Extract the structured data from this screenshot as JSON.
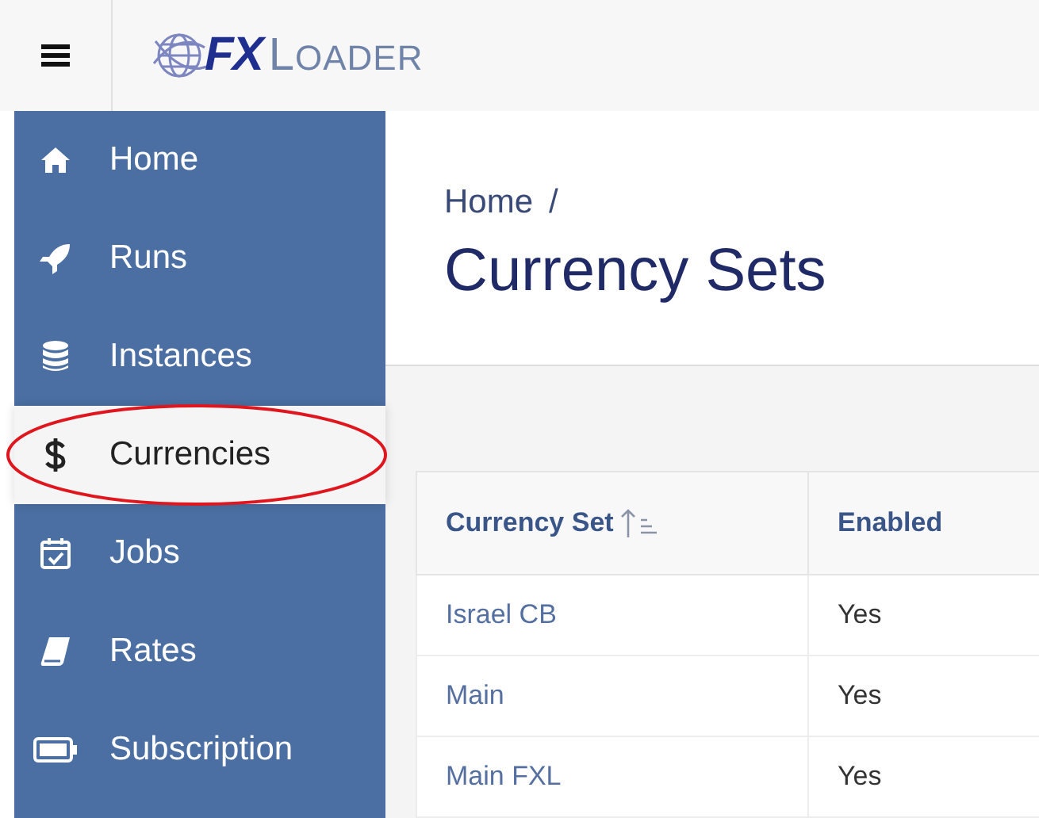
{
  "header": {
    "logo": {
      "bold": "FX",
      "light": "LOADER"
    }
  },
  "sidebar": {
    "items": [
      {
        "label": "Home",
        "selected": false,
        "circled": false
      },
      {
        "label": "Runs",
        "selected": false,
        "circled": false
      },
      {
        "label": "Instances",
        "selected": false,
        "circled": false
      },
      {
        "label": "Currencies",
        "selected": true,
        "circled": true
      },
      {
        "label": "Jobs",
        "selected": false,
        "circled": false
      },
      {
        "label": "Rates",
        "selected": false,
        "circled": false
      },
      {
        "label": "Subscription",
        "selected": false,
        "circled": false
      }
    ]
  },
  "breadcrumb": {
    "items": [
      "Home"
    ],
    "separator": "/"
  },
  "page_title": "Currency Sets",
  "table": {
    "columns": [
      {
        "label": "Currency Set",
        "sorted": true
      },
      {
        "label": "Enabled",
        "sorted": false
      }
    ],
    "rows": [
      [
        "Israel CB",
        "Yes"
      ],
      [
        "Main",
        "Yes"
      ],
      [
        "Main FXL",
        "Yes"
      ]
    ]
  }
}
